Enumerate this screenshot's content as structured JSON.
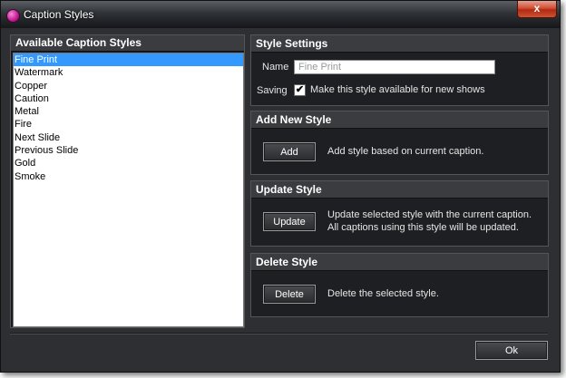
{
  "window": {
    "title": "Caption Styles",
    "close_label": "x"
  },
  "styles_panel": {
    "header": "Available Caption Styles",
    "items": [
      "Fine Print",
      "Watermark",
      "Copper",
      "Caution",
      "Metal",
      "Fire",
      "Next Slide",
      "Previous Slide",
      "Gold",
      "Smoke"
    ],
    "selected": "Fine Print"
  },
  "settings": {
    "header": "Style Settings",
    "name_label": "Name",
    "name_value": "Fine Print",
    "saving_label": "Saving",
    "saving_checked": true,
    "saving_text": "Make this style available for new shows"
  },
  "add_new": {
    "header": "Add New Style",
    "button_label": "Add",
    "description": "Add style based on current caption."
  },
  "update": {
    "header": "Update Style",
    "button_label": "Update",
    "description_line1": "Update selected style with the current caption.",
    "description_line2": "All captions using this style will be updated."
  },
  "delete": {
    "header": "Delete Style",
    "button_label": "Delete",
    "description": "Delete the selected style."
  },
  "footer": {
    "ok_label": "Ok"
  },
  "colors": {
    "selection": "#3399ff",
    "window_bg": "#2d2f33",
    "close_button": "#cf4d35"
  },
  "icons": {
    "app": "caption-app-icon",
    "check": "checkmark-icon"
  }
}
